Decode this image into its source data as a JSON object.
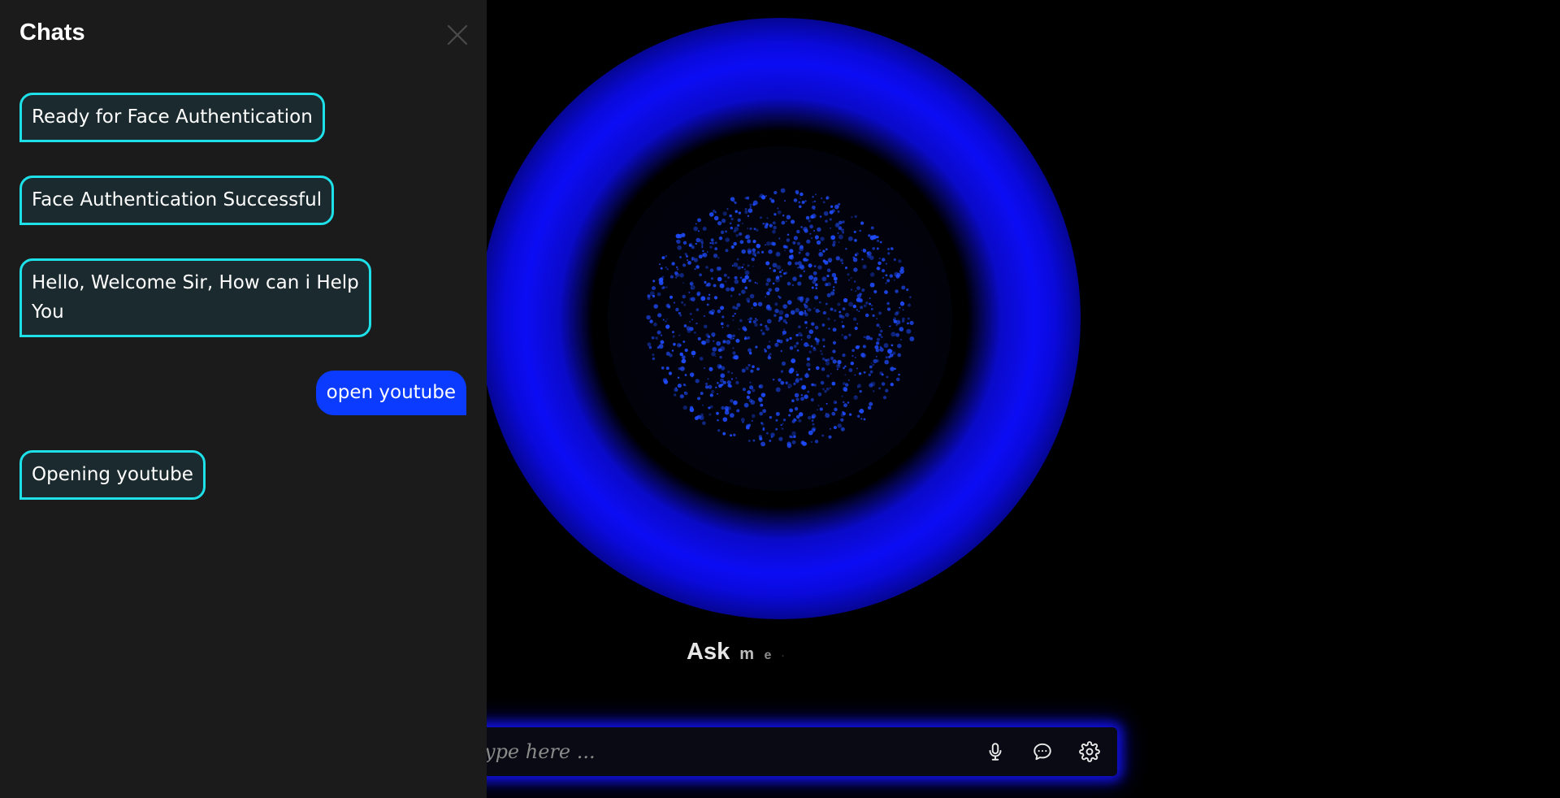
{
  "sidebar": {
    "title": "Chats",
    "messages": [
      {
        "sender": "bot",
        "text": "Ready for Face Authentication"
      },
      {
        "sender": "bot",
        "text": "Face Authentication Successful"
      },
      {
        "sender": "bot",
        "text": "Hello, Welcome Sir, How can i Help You"
      },
      {
        "sender": "user",
        "text": "open youtube"
      },
      {
        "sender": "bot",
        "text": "Opening youtube"
      }
    ]
  },
  "main": {
    "ask_word": "Ask",
    "ask_letters": [
      "m",
      "e",
      "·"
    ]
  },
  "input_bar": {
    "placeholder": "Type here ...",
    "icons": [
      "microphone-icon",
      "chat-bubble-icon",
      "gear-icon"
    ]
  },
  "colors": {
    "background": "#000000",
    "sidebar": "#1b1b1b",
    "bot_bubble_border": "#1ee0e8",
    "bot_bubble_fill": "#1b2a2e",
    "user_bubble": "#0b3bff",
    "orb_glow": "#0c0cf5",
    "orb_particles": "#1f4dff"
  }
}
